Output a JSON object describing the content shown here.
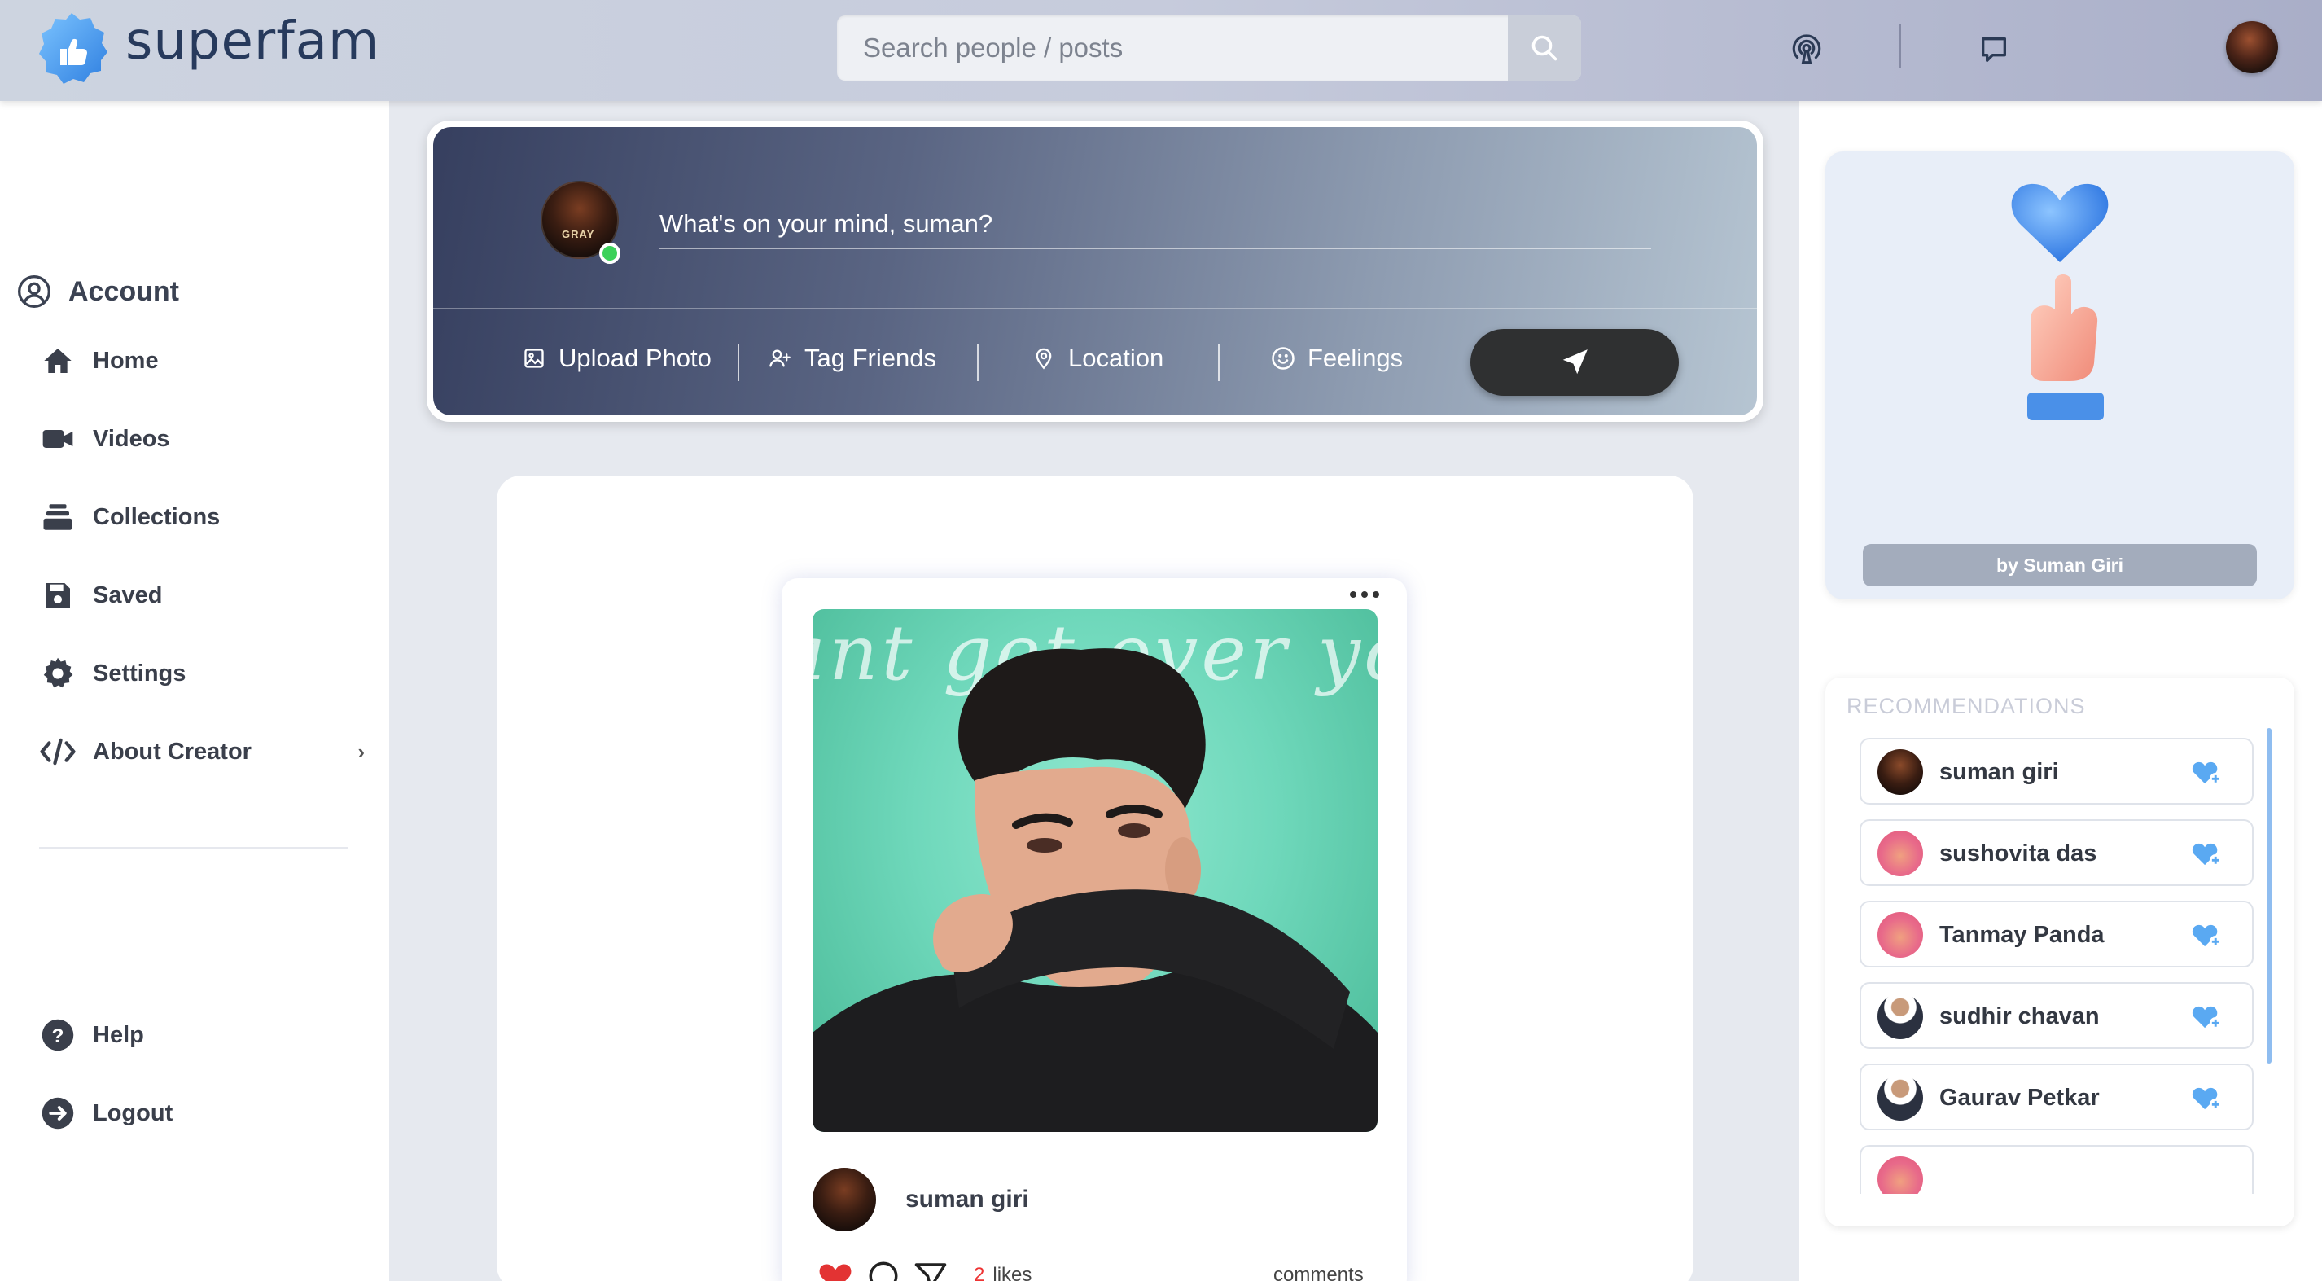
{
  "app": {
    "name": "superfam",
    "search": {
      "placeholder": "Search people / posts"
    }
  },
  "sidebar": {
    "heading": "Account",
    "items": [
      {
        "label": "Home",
        "icon": "home-icon"
      },
      {
        "label": "Videos",
        "icon": "video-camera-icon"
      },
      {
        "label": "Collections",
        "icon": "collections-icon"
      },
      {
        "label": "Saved",
        "icon": "save-icon"
      },
      {
        "label": "Settings",
        "icon": "gear-icon"
      },
      {
        "label": "About Creator",
        "icon": "code-icon"
      }
    ],
    "footer_items": [
      {
        "label": "Help",
        "icon": "help-icon"
      },
      {
        "label": "Logout",
        "icon": "logout-icon"
      }
    ]
  },
  "composer": {
    "placeholder": "What's on your mind, suman?",
    "actions": [
      {
        "label": "Upload Photo",
        "icon": "image-icon"
      },
      {
        "label": "Tag Friends",
        "icon": "user-plus-icon"
      },
      {
        "label": "Location",
        "icon": "location-pin-icon"
      },
      {
        "label": "Feelings",
        "icon": "smile-icon"
      }
    ],
    "avatar_mark": "GRAY"
  },
  "post": {
    "image_script": "ant get over yo",
    "username": "suman giri",
    "likes_count": "2",
    "likes_label": "likes",
    "comments_label": "comments"
  },
  "promo": {
    "credit": "by Suman Giri"
  },
  "recommendations": {
    "title": "RECOMMENDATIONS",
    "items": [
      {
        "name": "suman giri",
        "avatar": "dark"
      },
      {
        "name": "sushovita das",
        "avatar": "pink"
      },
      {
        "name": "Tanmay Panda",
        "avatar": "pink"
      },
      {
        "name": "sudhir chavan",
        "avatar": "suit"
      },
      {
        "name": "Gaurav Petkar",
        "avatar": "suit"
      },
      {
        "name": "",
        "avatar": "pink"
      }
    ]
  },
  "colors": {
    "brand": "#273a5c",
    "accent_blue": "#4ea1f5",
    "send_button": "#2f3031",
    "online": "#3cd15a",
    "like": "#e33333"
  }
}
